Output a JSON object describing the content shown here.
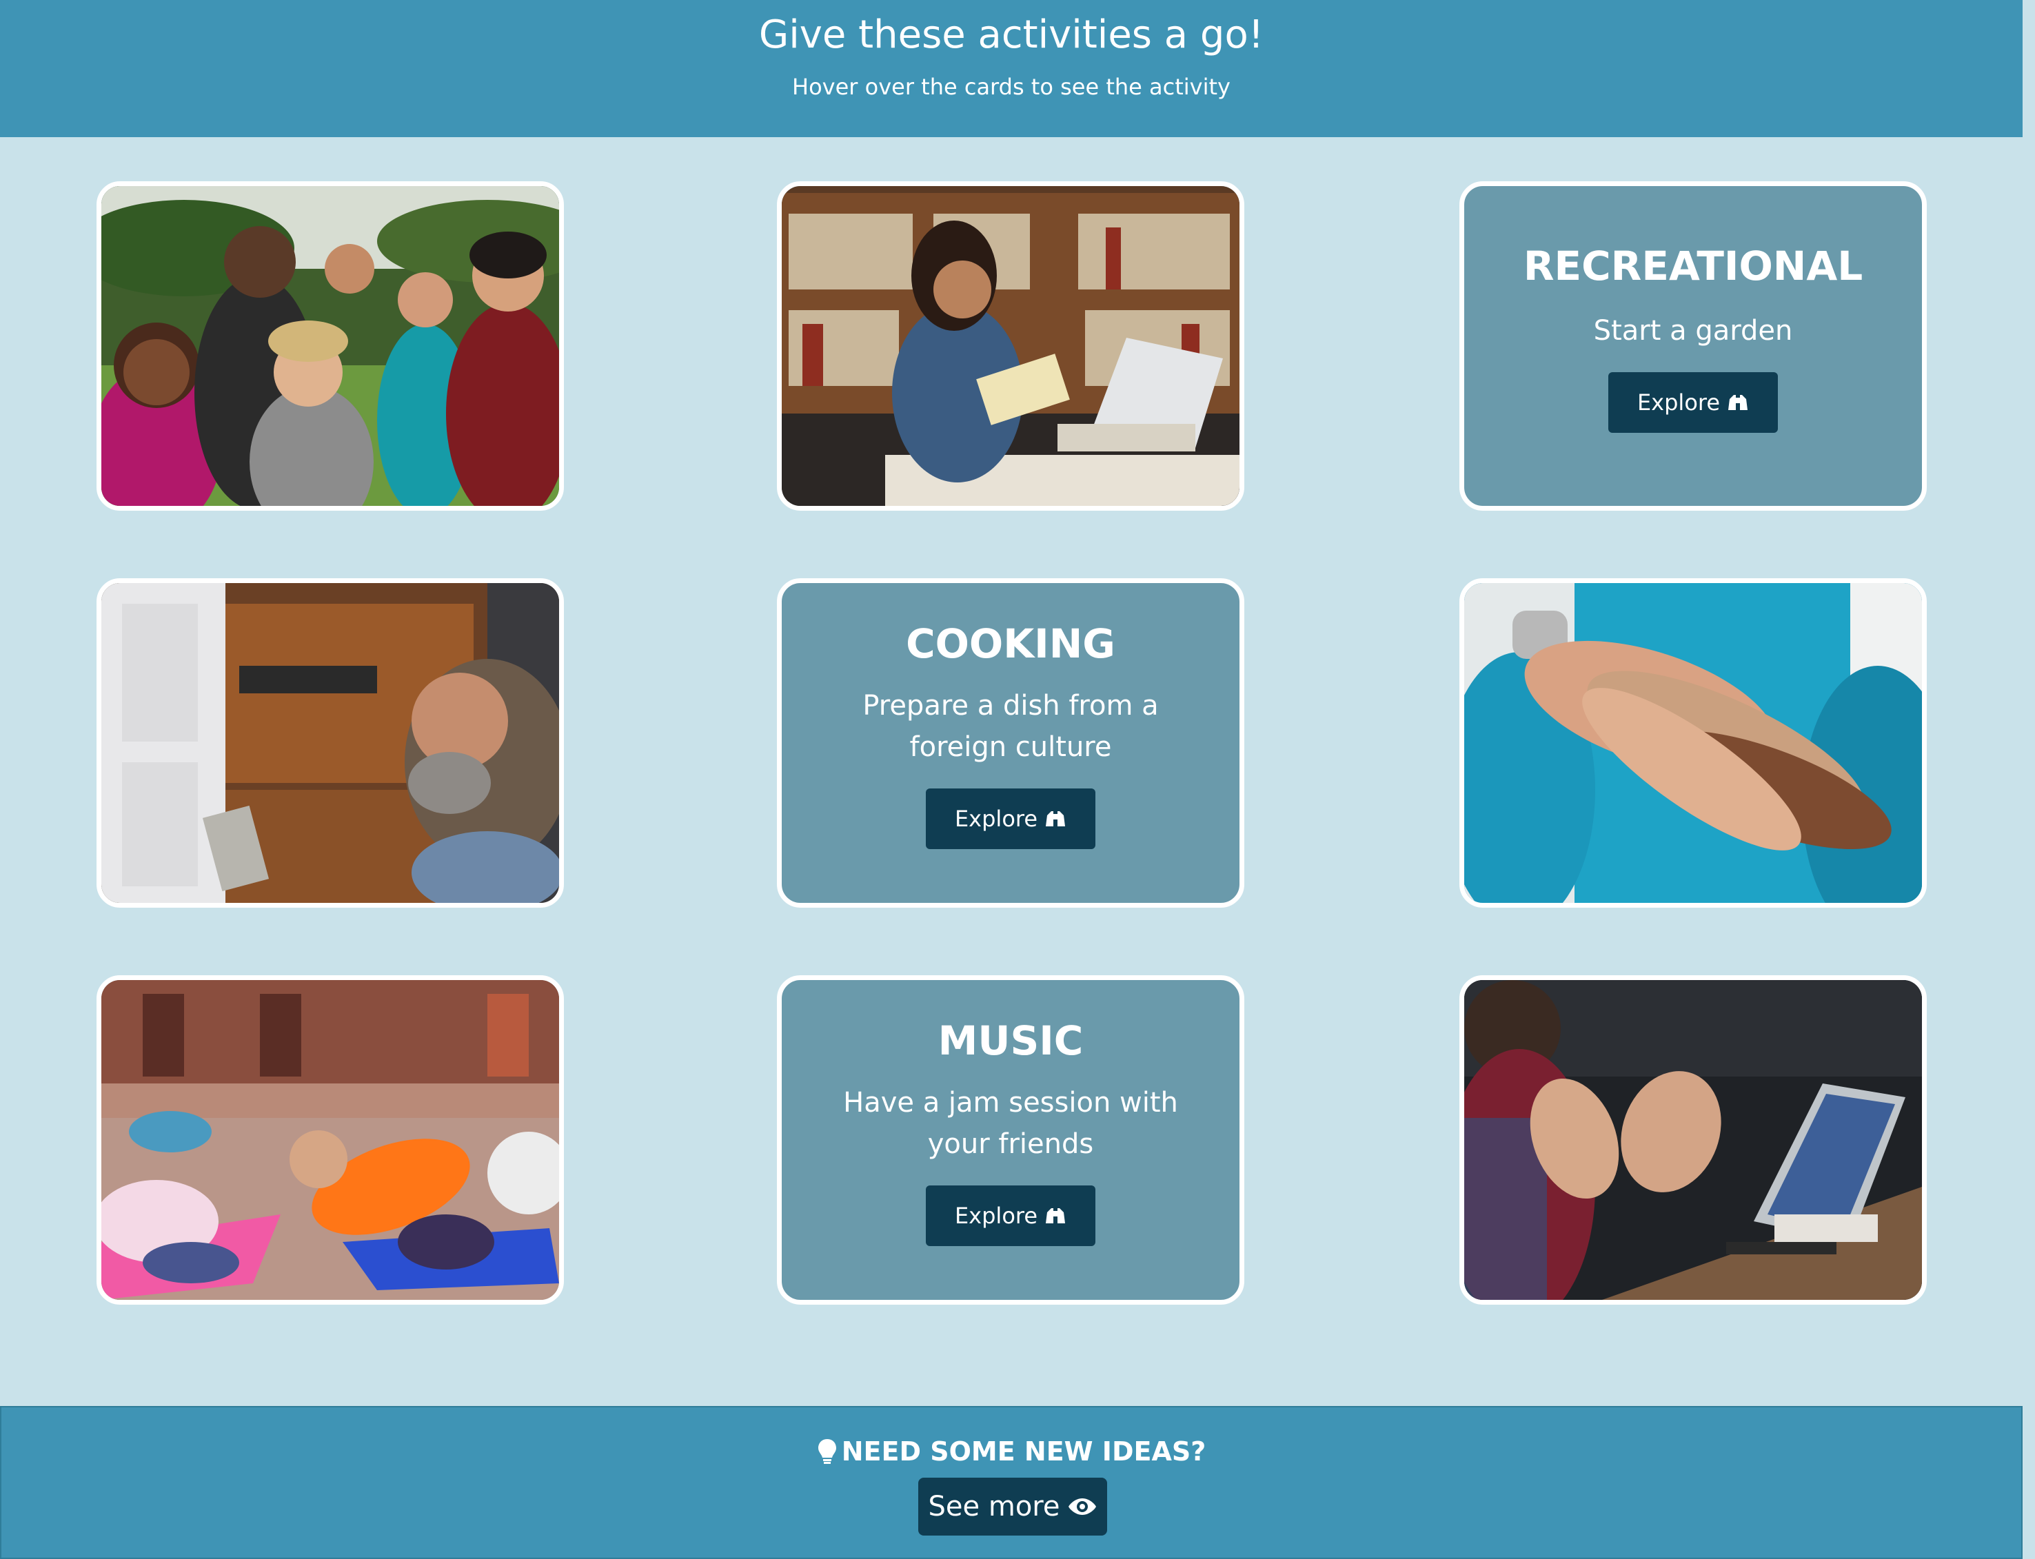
{
  "header": {
    "title": "Give these activities a go!",
    "subtitle": "Hover over the cards to see the activity"
  },
  "cards": [
    {
      "kind": "image",
      "image_icon": "group-of-friends-cheering-photo"
    },
    {
      "kind": "image",
      "image_icon": "woman-reading-in-library-photo"
    },
    {
      "kind": "text",
      "category": "RECREATIONAL",
      "description": "Start a garden",
      "button_label": "Explore",
      "button_icon": "binoculars-icon"
    },
    {
      "kind": "image",
      "image_icon": "man-repairing-drawer-photo"
    },
    {
      "kind": "text",
      "category": "COOKING",
      "description": "Prepare a dish from a foreign culture",
      "button_label": "Explore",
      "button_icon": "binoculars-icon"
    },
    {
      "kind": "image",
      "image_icon": "stacked-hands-volunteers-photo"
    },
    {
      "kind": "image",
      "image_icon": "group-yoga-class-photo"
    },
    {
      "kind": "text",
      "category": "MUSIC",
      "description": "Have a jam session with your friends",
      "button_label": "Explore",
      "button_icon": "binoculars-icon"
    },
    {
      "kind": "image",
      "image_icon": "meeting-with-laptop-photo"
    }
  ],
  "footer": {
    "ideas_label": "NEED SOME NEW IDEAS?",
    "ideas_icon": "lightbulb-icon",
    "see_more_label": "See more",
    "see_more_icon": "eye-icon"
  },
  "colors": {
    "page_background": "#c9e2ea",
    "header_background": "#3f94b5",
    "card_text_background": "#6a9aab",
    "button_background": "#0f3d52"
  }
}
